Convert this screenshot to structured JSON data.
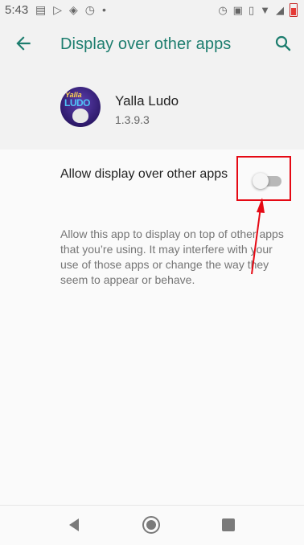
{
  "status_bar": {
    "time": "5:43",
    "left_icons": [
      "message-icon",
      "play-store-icon",
      "bird-icon",
      "alarm-icon",
      "dot-icon"
    ],
    "right_icons": [
      "alarm-icon",
      "nfc-icon",
      "vibrate-icon",
      "wifi-icon",
      "signal-icon",
      "battery-icon"
    ]
  },
  "app_bar": {
    "title": "Display over other apps"
  },
  "app": {
    "name": "Yalla Ludo",
    "version": "1.3.9.3",
    "icon_top_text": "Yalla",
    "icon_main_text": "LUDO"
  },
  "setting": {
    "title": "Allow display over other apps",
    "toggle_on": false,
    "description": "Allow this app to display on top of other apps that you’re using. It may interfere with your use of those apps or change the way they seem to appear or behave."
  },
  "colors": {
    "accent": "#1c7d6e",
    "annotation": "#e50914"
  }
}
